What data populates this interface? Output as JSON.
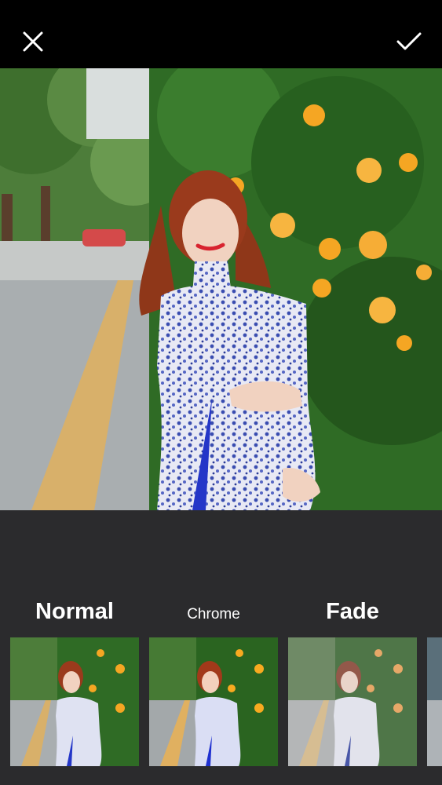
{
  "toolbar": {
    "close_icon": "close-icon",
    "confirm_icon": "checkmark-icon"
  },
  "filters": [
    {
      "label": "Normal"
    },
    {
      "label": "Chrome"
    },
    {
      "label": "Fade"
    }
  ],
  "colors": {
    "top_bar": "#000000",
    "panel": "#2b2b2d",
    "foliage": "#2f6b25",
    "flowers": "#f5a623",
    "dress": "#3b4fb5",
    "hair": "#9a3a1c"
  }
}
